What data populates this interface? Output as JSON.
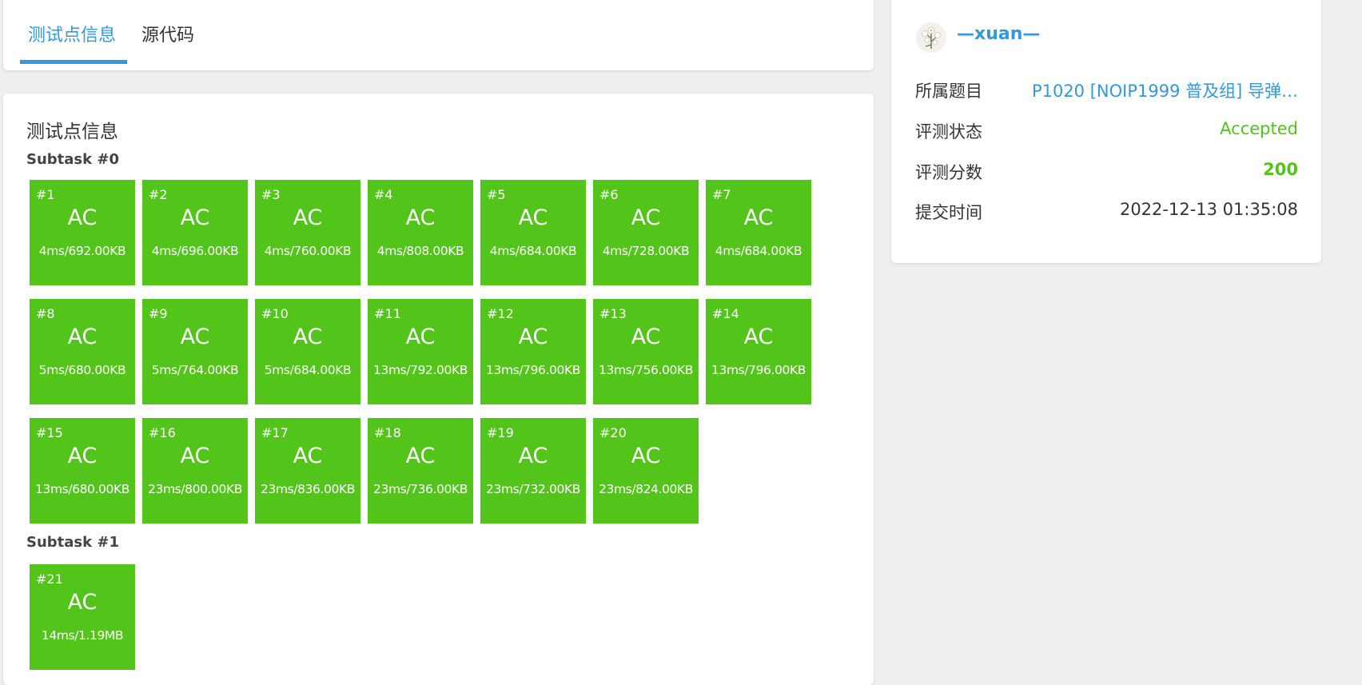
{
  "tabs": {
    "testcases": "测试点信息",
    "source": "源代码"
  },
  "main": {
    "title": "测试点信息",
    "subtasks": [
      {
        "title": "Subtask #0",
        "cases": [
          {
            "num": "#1",
            "status": "AC",
            "info": "4ms/692.00KB"
          },
          {
            "num": "#2",
            "status": "AC",
            "info": "4ms/696.00KB"
          },
          {
            "num": "#3",
            "status": "AC",
            "info": "4ms/760.00KB"
          },
          {
            "num": "#4",
            "status": "AC",
            "info": "4ms/808.00KB"
          },
          {
            "num": "#5",
            "status": "AC",
            "info": "4ms/684.00KB"
          },
          {
            "num": "#6",
            "status": "AC",
            "info": "4ms/728.00KB"
          },
          {
            "num": "#7",
            "status": "AC",
            "info": "4ms/684.00KB"
          },
          {
            "num": "#8",
            "status": "AC",
            "info": "5ms/680.00KB"
          },
          {
            "num": "#9",
            "status": "AC",
            "info": "5ms/764.00KB"
          },
          {
            "num": "#10",
            "status": "AC",
            "info": "5ms/684.00KB"
          },
          {
            "num": "#11",
            "status": "AC",
            "info": "13ms/792.00KB"
          },
          {
            "num": "#12",
            "status": "AC",
            "info": "13ms/796.00KB"
          },
          {
            "num": "#13",
            "status": "AC",
            "info": "13ms/756.00KB"
          },
          {
            "num": "#14",
            "status": "AC",
            "info": "13ms/796.00KB"
          },
          {
            "num": "#15",
            "status": "AC",
            "info": "13ms/680.00KB"
          },
          {
            "num": "#16",
            "status": "AC",
            "info": "23ms/800.00KB"
          },
          {
            "num": "#17",
            "status": "AC",
            "info": "23ms/836.00KB"
          },
          {
            "num": "#18",
            "status": "AC",
            "info": "23ms/736.00KB"
          },
          {
            "num": "#19",
            "status": "AC",
            "info": "23ms/732.00KB"
          },
          {
            "num": "#20",
            "status": "AC",
            "info": "23ms/824.00KB"
          }
        ]
      },
      {
        "title": "Subtask #1",
        "cases": [
          {
            "num": "#21",
            "status": "AC",
            "info": "14ms/1.19MB"
          }
        ]
      }
    ]
  },
  "info": {
    "username": "—xuan—",
    "problem_label": "所属题目",
    "problem_value": "P1020 [NOIP1999 普及组] 导弹…",
    "status_label": "评测状态",
    "status_value": "Accepted",
    "score_label": "评测分数",
    "score_value": "200",
    "time_label": "提交时间",
    "time_value": "2022-12-13 01:35:08"
  },
  "colors": {
    "accent": "#3498db",
    "ac_green": "#52c41a",
    "background": "#efefef"
  },
  "icons": {
    "avatar": "flower-avatar-icon"
  }
}
